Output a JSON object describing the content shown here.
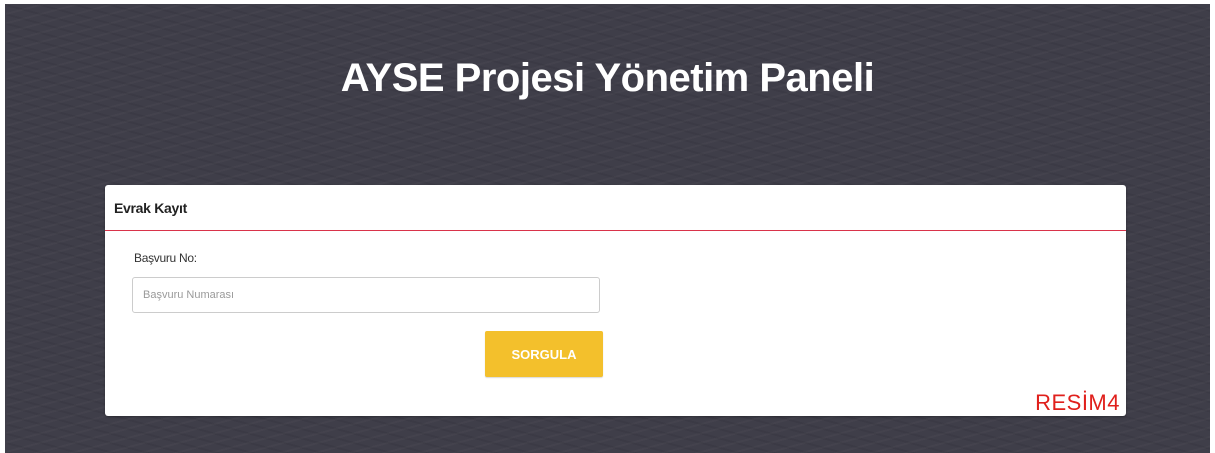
{
  "page": {
    "title": "AYSE Projesi Yönetim Paneli"
  },
  "card": {
    "title": "Evrak Kayıt",
    "field_label": "Başvuru No:",
    "input_placeholder": "Başvuru Numarası",
    "input_value": "",
    "button_label": "SORGULA"
  },
  "annotation": {
    "label": "RESİM4"
  },
  "colors": {
    "background": "#3f3e49",
    "accent_line": "#d9334a",
    "button": "#f3c02c",
    "annotation": "#e0201c"
  }
}
